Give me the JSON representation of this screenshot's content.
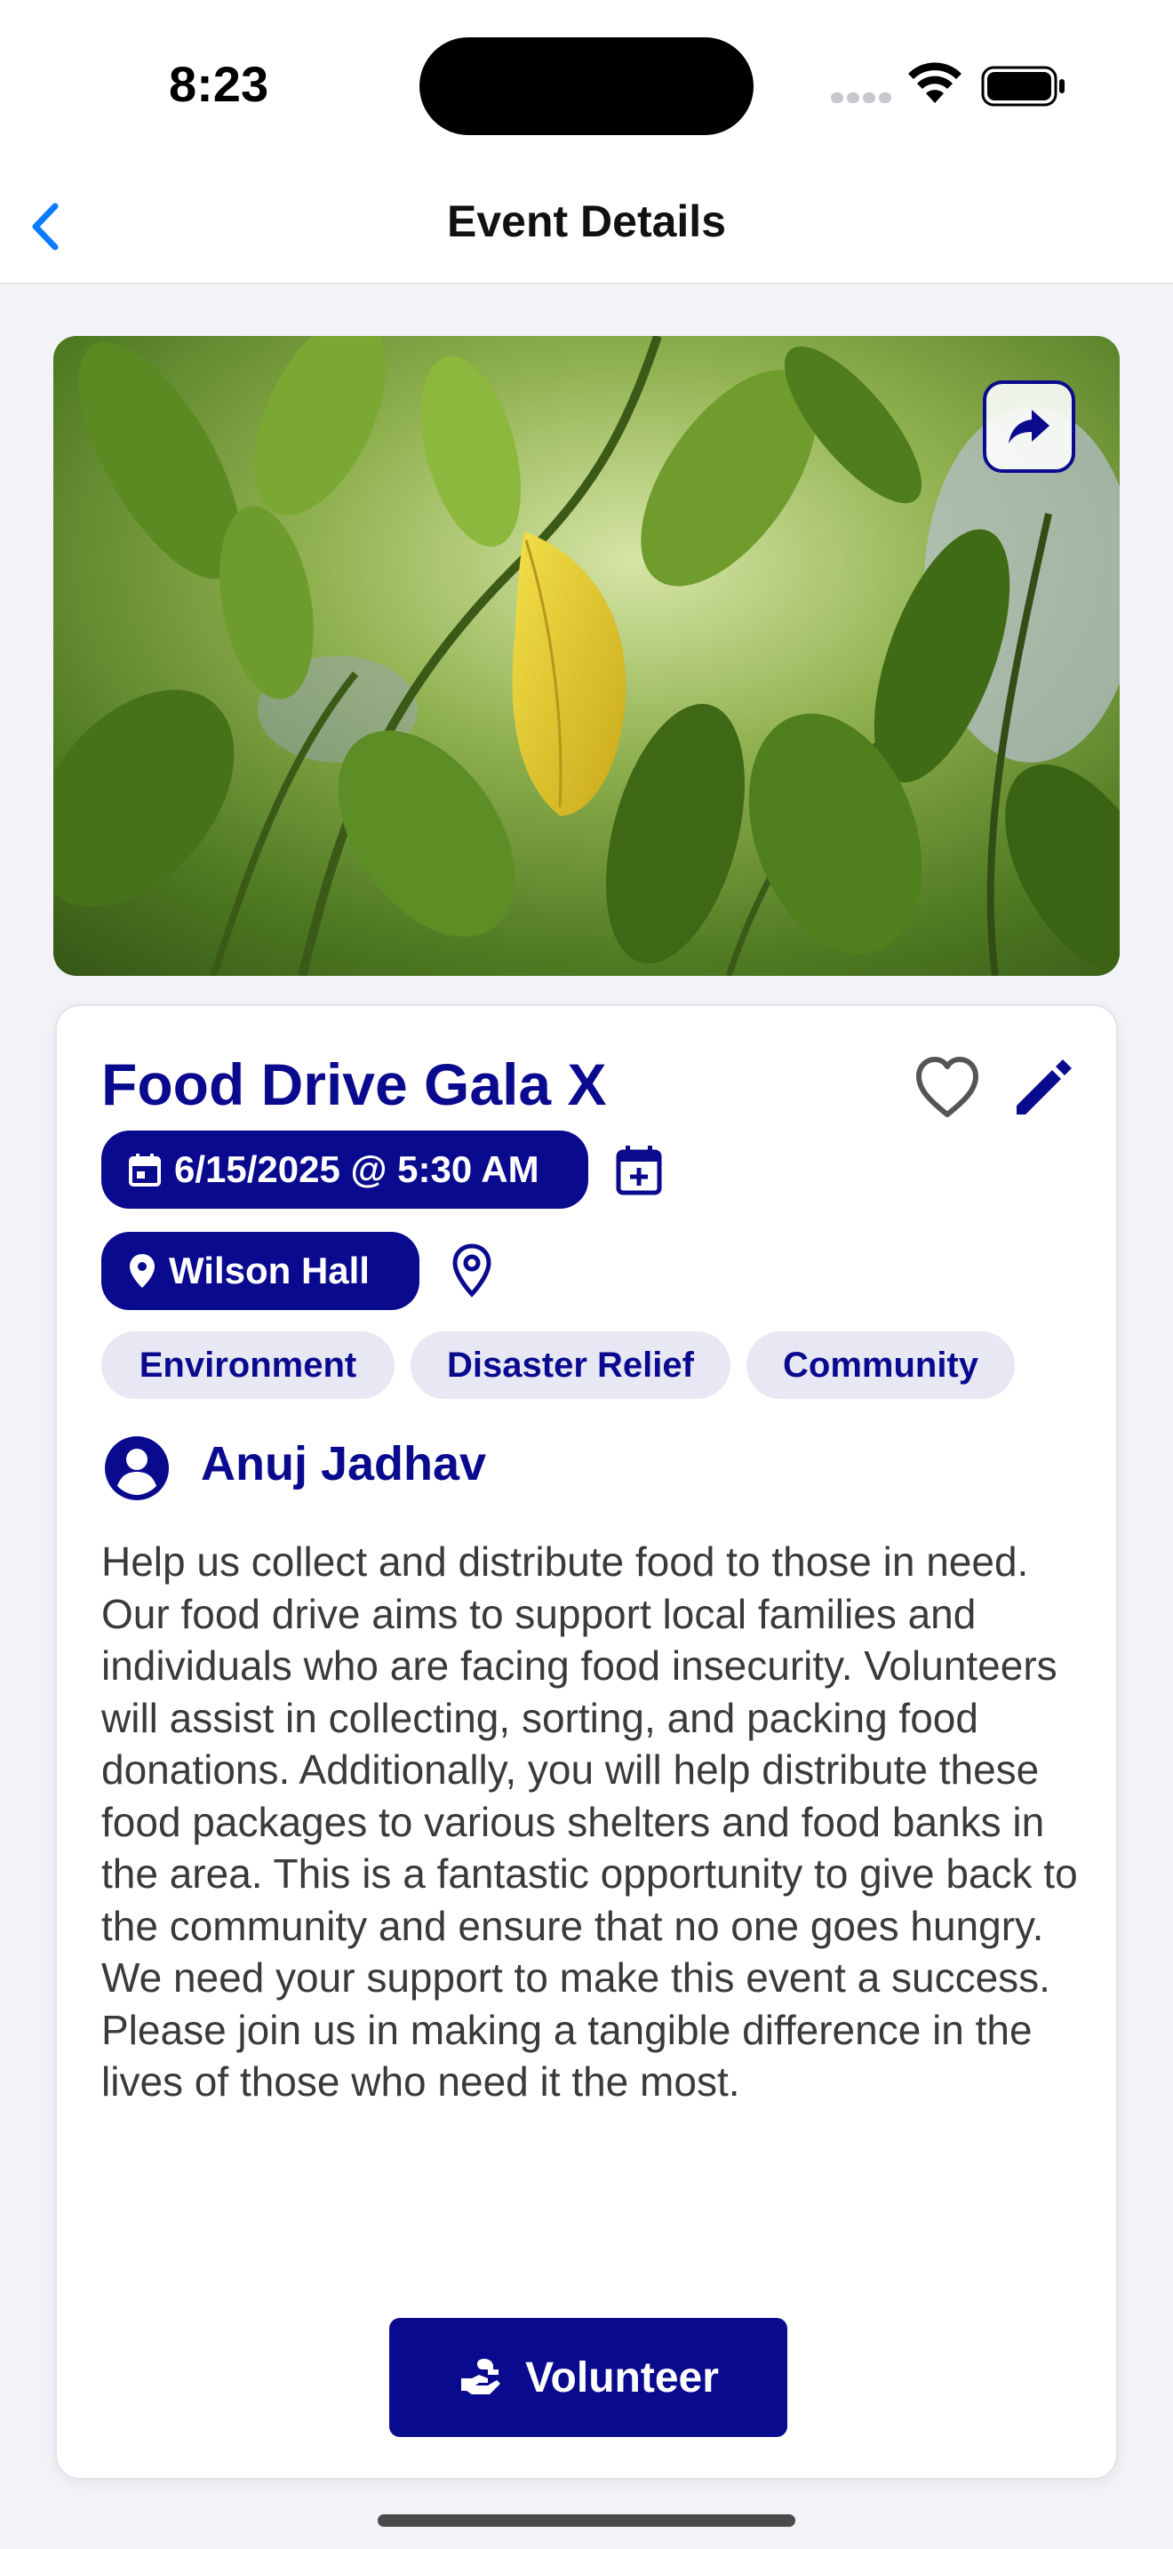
{
  "status_bar": {
    "time": "8:23"
  },
  "nav": {
    "title": "Event Details"
  },
  "event": {
    "title": "Food Drive Gala X",
    "datetime": "6/15/2025 @ 5:30 AM",
    "location": "Wilson Hall",
    "tags": [
      "Environment",
      "Disaster Relief",
      "Community"
    ],
    "organizer": "Anuj Jadhav",
    "description": "Help us collect and distribute food to those in need. Our food drive aims to support local families and individuals who are facing food insecurity. Volunteers will assist in collecting, sorting, and packing food donations. Additionally, you will help distribute these food packages to various shelters and food banks in the area. This is a fantastic opportunity to give back to the community and ensure that no one goes hungry. We need your support to make this event a success. Please join us in making a tangible difference in the lives of those who need it the most."
  },
  "actions": {
    "volunteer_label": "Volunteer"
  },
  "icons": {
    "back": "chevron-left-icon",
    "share": "share-arrow-icon",
    "favorite": "heart-outline-icon",
    "edit": "pencil-icon",
    "date": "calendar-icon",
    "add_calendar": "calendar-plus-icon",
    "location": "map-pin-icon",
    "organizer": "user-circle-icon",
    "volunteer": "helping-hands-icon"
  },
  "colors": {
    "brand": "#0a0a8f",
    "ios_blue": "#0a7aff",
    "tag_bg": "#e8e8f4",
    "page_bg": "#f2f2f7"
  }
}
